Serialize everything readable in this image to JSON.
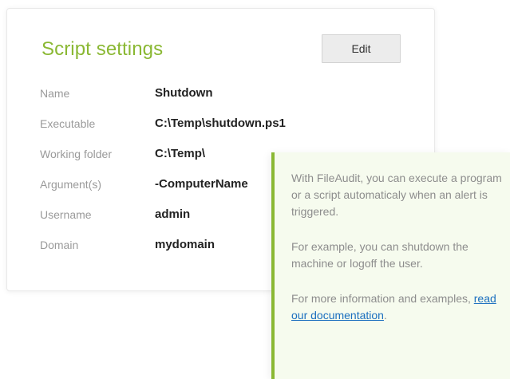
{
  "settings": {
    "title": "Script settings",
    "edit_label": "Edit",
    "fields": [
      {
        "label": "Name",
        "value": "Shutdown"
      },
      {
        "label": "Executable",
        "value": "C:\\Temp\\shutdown.ps1"
      },
      {
        "label": "Working folder",
        "value": "C:\\Temp\\"
      },
      {
        "label": "Argument(s)",
        "value": "-ComputerName"
      },
      {
        "label": "Username",
        "value": "admin"
      },
      {
        "label": "Domain",
        "value": "mydomain"
      }
    ]
  },
  "tip": {
    "paragraph1": "With FileAudit, you can execute a program or a script automaticaly when an alert is triggered.",
    "paragraph2": "For example, you can shutdown the machine or logoff the user.",
    "paragraph3_prefix": "For more information and examples, ",
    "paragraph3_link": "read our documentation",
    "paragraph3_suffix": "."
  },
  "colors": {
    "accent": "#8ab833",
    "tip_background": "#f6fbee",
    "link": "#1b6fbf",
    "label": "#9a9a9a",
    "value": "#222222"
  }
}
